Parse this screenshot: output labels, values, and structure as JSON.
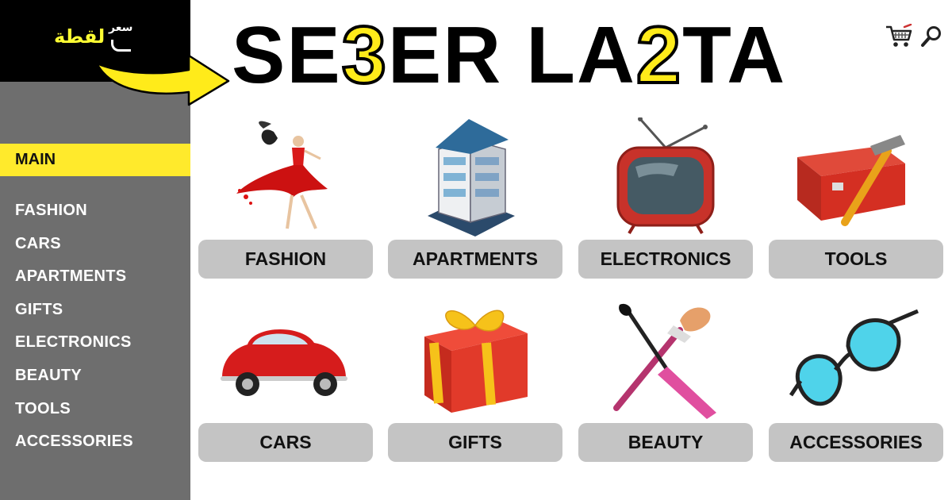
{
  "brand": {
    "logo_small": "سعر",
    "logo_arabic": "لقطة",
    "title_parts": [
      "SE",
      "3",
      "ER LA",
      "2",
      "TA"
    ]
  },
  "sidebar": {
    "main_label": "MAIN",
    "items": [
      "FASHION",
      "CARS",
      "APARTMENTS",
      "GIFTS",
      "ELECTRONICS",
      "BEAUTY",
      "TOOLS",
      "ACCESSORIES"
    ]
  },
  "header": {
    "cart_icon": "shopping-cart-icon",
    "search_icon": "magnifier-icon"
  },
  "categories": [
    {
      "label": "FASHION",
      "icon": "fashion-model"
    },
    {
      "label": "APARTMENTS",
      "icon": "apartment-building"
    },
    {
      "label": "ELECTRONICS",
      "icon": "retro-tv"
    },
    {
      "label": "TOOLS",
      "icon": "toolbox-hammer"
    },
    {
      "label": "CARS",
      "icon": "red-car"
    },
    {
      "label": "GIFTS",
      "icon": "gift-box"
    },
    {
      "label": "BEAUTY",
      "icon": "makeup-brushes"
    },
    {
      "label": "ACCESSORIES",
      "icon": "sunglasses"
    }
  ],
  "colors": {
    "accent_yellow": "#ffea2c",
    "sidebar_gray": "#6e6e6e",
    "logo_black": "#000000",
    "button_gray": "#c4c4c4"
  }
}
